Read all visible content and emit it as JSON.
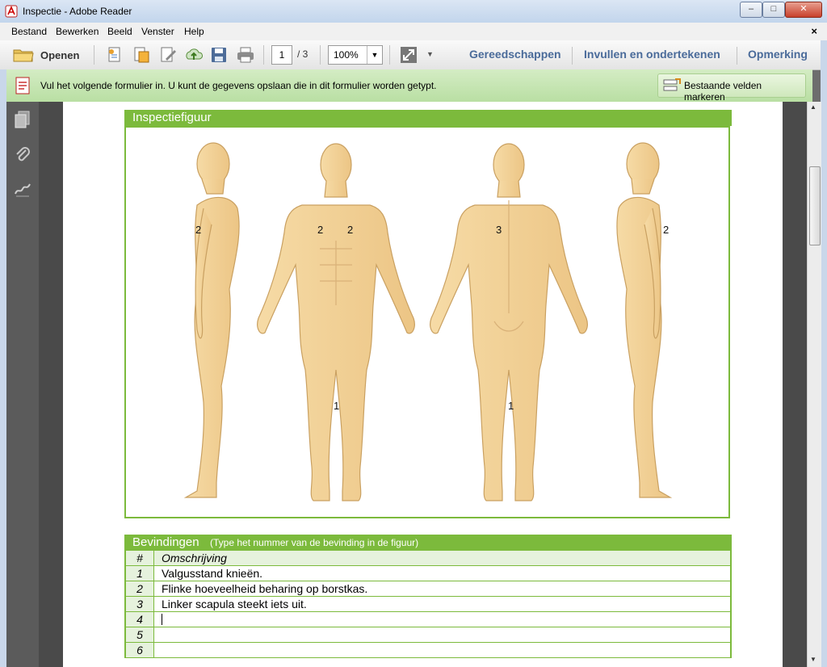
{
  "window": {
    "title": "Inspectie - Adobe Reader",
    "controls": {
      "minimize": "–",
      "maximize": "□",
      "close": "✕"
    }
  },
  "menubar": {
    "items": [
      "Bestand",
      "Bewerken",
      "Beeld",
      "Venster",
      "Help"
    ],
    "close_doc": "×"
  },
  "toolbar": {
    "open_label": "Openen",
    "page_current": "1",
    "page_total": "/ 3",
    "zoom": "100%",
    "panels": [
      "Gereedschappen",
      "Invullen en ondertekenen",
      "Opmerking"
    ]
  },
  "formbar": {
    "message": "Vul het volgende formulier in. U kunt de gegevens opslaan die in dit formulier worden getypt.",
    "mark_button": "Bestaande velden markeren"
  },
  "document": {
    "figure_title": "Inspectiefiguur",
    "figure_markers": [
      "2",
      "2",
      "2",
      "3",
      "2",
      "1",
      "1"
    ],
    "findings_title": "Bevindingen",
    "findings_hint": "(Type het nummer van de bevinding in de figuur)",
    "table_header": {
      "num": "#",
      "desc": "Omschrijving"
    },
    "rows": [
      {
        "num": "1",
        "desc": "Valgusstand knieën."
      },
      {
        "num": "2",
        "desc": "Flinke hoeveelheid beharing op borstkas."
      },
      {
        "num": "3",
        "desc": "Linker scapula steekt iets uit."
      },
      {
        "num": "4",
        "desc": ""
      },
      {
        "num": "5",
        "desc": ""
      },
      {
        "num": "6",
        "desc": ""
      }
    ]
  },
  "colors": {
    "section_green": "#7cba3c",
    "form_bar": "#c6e6b2",
    "skin": "#f3d49a",
    "skin_outline": "#c9a061"
  }
}
